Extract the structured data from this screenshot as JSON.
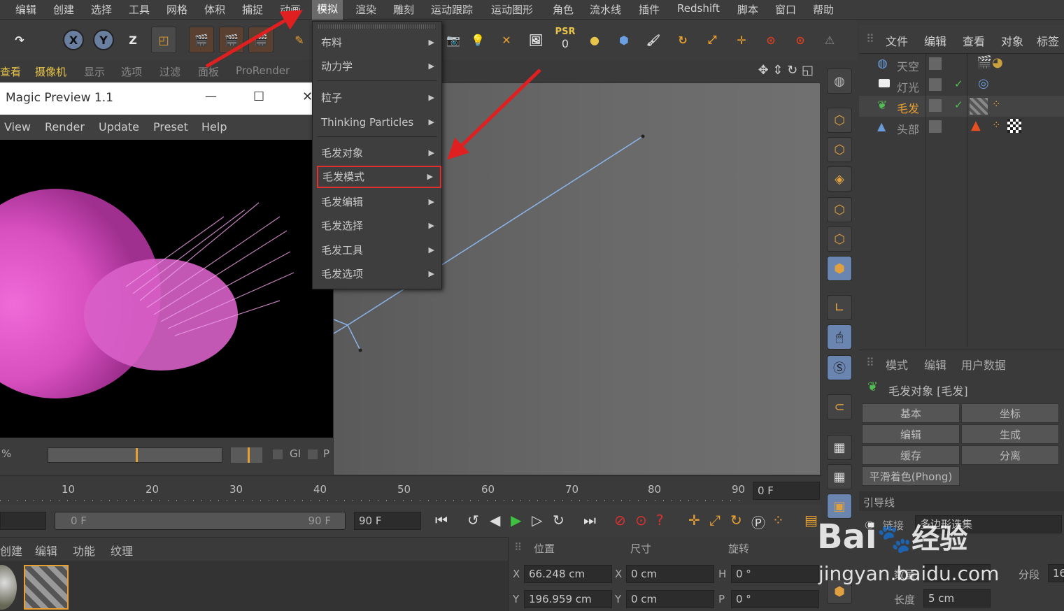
{
  "menubar": {
    "items": [
      "编辑",
      "创建",
      "选择",
      "工具",
      "网格",
      "体积",
      "捕捉",
      "动画",
      "模拟",
      "渲染",
      "雕刻",
      "运动跟踪",
      "运动图形",
      "角色",
      "流水线",
      "插件",
      "Redshift",
      "脚本",
      "窗口",
      "帮助"
    ],
    "active": "模拟"
  },
  "subbar": {
    "items": [
      "查看",
      "摄像机",
      "显示",
      "选项",
      "过滤",
      "面板",
      "ProRender"
    ]
  },
  "magic_preview": {
    "title": "Magic Preview 1.1",
    "menu": [
      "View",
      "Render",
      "Update",
      "Preset",
      "Help"
    ],
    "minimize": "—",
    "maximize": "☐",
    "close": "✕",
    "percent": "%",
    "gi_label": "GI",
    "p_label": "P"
  },
  "dropdown": {
    "items": [
      {
        "label": "布料",
        "submenu": true
      },
      {
        "label": "动力学",
        "submenu": true
      },
      {
        "label": "粒子",
        "submenu": true
      },
      {
        "label": "Thinking Particles",
        "submenu": true
      },
      {
        "label": "毛发对象",
        "submenu": true
      },
      {
        "label": "毛发模式",
        "submenu": true,
        "highlighted": true
      },
      {
        "label": "毛发编辑",
        "submenu": true
      },
      {
        "label": "毛发选择",
        "submenu": true
      },
      {
        "label": "毛发工具",
        "submenu": true
      },
      {
        "label": "毛发选项",
        "submenu": true
      }
    ]
  },
  "toolbar": {
    "x": "X",
    "y": "Y",
    "z": "Z",
    "psr": "PSR",
    "psr_value": "0"
  },
  "object_manager": {
    "header": [
      "文件",
      "编辑",
      "查看",
      "对象",
      "标签"
    ],
    "objects": [
      {
        "name": "天空",
        "selected": false
      },
      {
        "name": "灯光",
        "selected": false
      },
      {
        "name": "毛发",
        "selected": true
      },
      {
        "name": "头部",
        "selected": false
      }
    ]
  },
  "attribute_manager": {
    "header": [
      "模式",
      "编辑",
      "用户数据"
    ],
    "title": "毛发对象 [毛发]",
    "tabs": [
      "基本",
      "坐标",
      "编辑",
      "生成",
      "缓存",
      "分离"
    ],
    "phong": "平滑着色(Phong)",
    "section": "引导线",
    "link_label": "链接",
    "link_value": "多边形选集",
    "count_label": "数量",
    "segment_label": "分段",
    "segment_value": "16",
    "length_label": "长度",
    "length_value": "5 cm"
  },
  "timeline": {
    "ticks": [
      "10",
      "20",
      "30",
      "40",
      "50",
      "60",
      "70",
      "80",
      "90"
    ],
    "frame_field": "0 F",
    "range_start": "0 F",
    "range_end": "90 F",
    "end_field": "90 F"
  },
  "material_bar": {
    "items": [
      "创建",
      "编辑",
      "功能",
      "纹理"
    ]
  },
  "coordinates": {
    "headers": [
      "位置",
      "尺寸",
      "旋转"
    ],
    "rows": [
      {
        "axis": "X",
        "pos": "66.248 cm",
        "size_axis": "X",
        "size": "0 cm",
        "rot_axis": "H",
        "rot": "0 °"
      },
      {
        "axis": "Y",
        "pos": "196.959 cm",
        "size_axis": "Y",
        "size": "0 cm",
        "rot_axis": "P",
        "rot": "0 °"
      }
    ]
  },
  "watermark": {
    "brand": "Bai",
    "brand2": "经验",
    "url": "jingyan.baidu.com"
  }
}
